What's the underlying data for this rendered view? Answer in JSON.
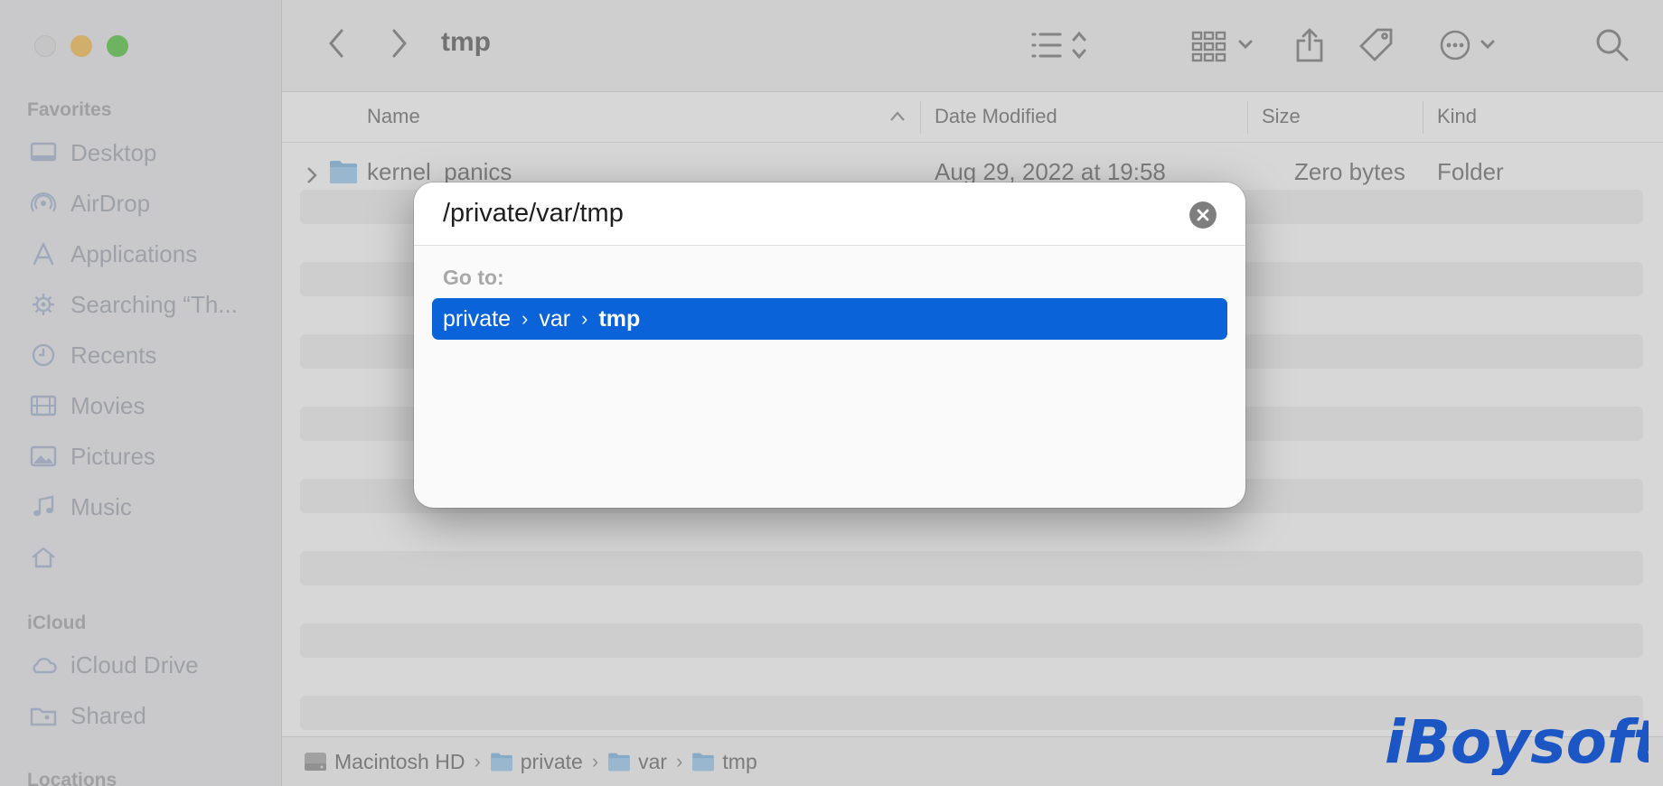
{
  "window": {
    "title": "tmp"
  },
  "sidebar": {
    "favorites_header": "Favorites",
    "favorites": [
      {
        "label": "Desktop",
        "icon": "desktop-icon"
      },
      {
        "label": "AirDrop",
        "icon": "airdrop-icon"
      },
      {
        "label": "Applications",
        "icon": "applications-icon"
      },
      {
        "label": "Searching “Th...",
        "icon": "gear-icon"
      },
      {
        "label": "Recents",
        "icon": "clock-icon"
      },
      {
        "label": "Movies",
        "icon": "film-icon"
      },
      {
        "label": "Pictures",
        "icon": "photo-icon"
      },
      {
        "label": "Music",
        "icon": "music-note-icon"
      },
      {
        "label": "",
        "icon": "home-icon"
      }
    ],
    "icloud_header": "iCloud",
    "icloud": [
      {
        "label": "iCloud Drive",
        "icon": "cloud-icon"
      },
      {
        "label": "Shared",
        "icon": "shared-folder-icon"
      }
    ],
    "locations_header": "Locations"
  },
  "columns": {
    "name": "Name",
    "date_modified": "Date Modified",
    "size": "Size",
    "kind": "Kind"
  },
  "files": [
    {
      "name": "kernel_panics",
      "date_modified": "Aug 29, 2022 at 19:58",
      "size": "Zero bytes",
      "kind": "Folder"
    }
  ],
  "pathbar": [
    {
      "label": "Macintosh HD",
      "icon": "hard-drive-icon"
    },
    {
      "label": "private",
      "icon": "folder-icon"
    },
    {
      "label": "var",
      "icon": "folder-icon"
    },
    {
      "label": "tmp",
      "icon": "folder-icon"
    }
  ],
  "goto_dialog": {
    "input_value": "/private/var/tmp",
    "goto_label": "Go to:",
    "suggestion": {
      "parts": [
        "private",
        "var"
      ],
      "last": "tmp"
    }
  },
  "watermark": {
    "text": "iBoysoft"
  },
  "colors": {
    "selection": "#0a63d8",
    "folder": "#7fb7e6",
    "sidebar_icon": "#a4b6d4"
  }
}
